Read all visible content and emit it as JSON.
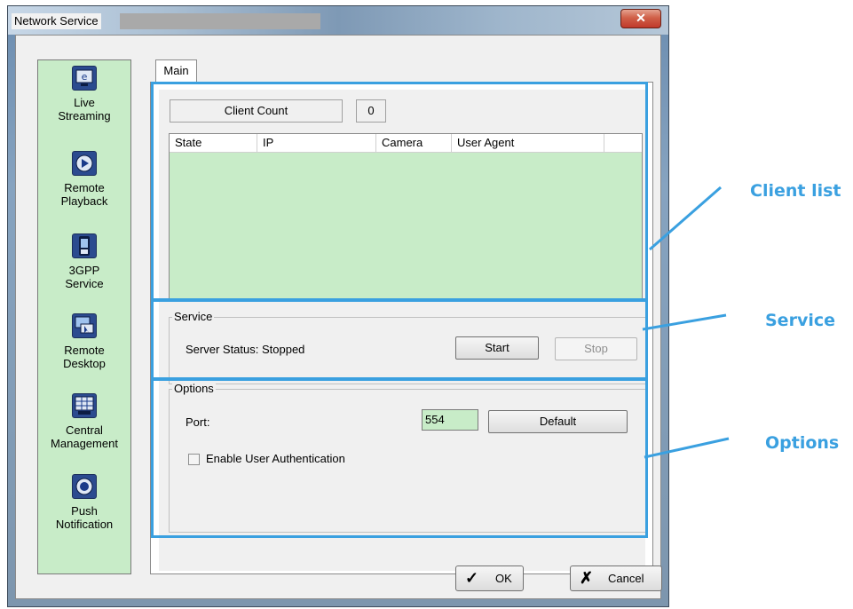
{
  "window": {
    "title": "Network Service",
    "close_glyph": "✕"
  },
  "sidebar": {
    "items": [
      {
        "label_lines": [
          "Live",
          "Streaming"
        ],
        "icon": "live-streaming-icon"
      },
      {
        "label_lines": [
          "Remote",
          "Playback"
        ],
        "icon": "remote-playback-icon"
      },
      {
        "label_lines": [
          "3GPP",
          "Service"
        ],
        "icon": "3gpp-service-icon"
      },
      {
        "label_lines": [
          "Remote",
          "Desktop"
        ],
        "icon": "remote-desktop-icon"
      },
      {
        "label_lines": [
          "Central",
          "Management"
        ],
        "icon": "central-management-icon"
      },
      {
        "label_lines": [
          "Push",
          "Notification"
        ],
        "icon": "push-notification-icon"
      }
    ]
  },
  "tabs": [
    {
      "label": "Main"
    }
  ],
  "client_list": {
    "count_label": "Client Count",
    "count_value": "0",
    "columns": [
      "State",
      "IP",
      "Camera",
      "User Agent"
    ],
    "rows": []
  },
  "service": {
    "group_label": "Service",
    "status_text": "Server Status: Stopped",
    "start_label": "Start",
    "stop_label": "Stop"
  },
  "options": {
    "group_label": "Options",
    "port_label": "Port:",
    "port_value": "554",
    "default_label": "Default",
    "auth_label": "Enable User Authentication",
    "auth_checked": false
  },
  "footer": {
    "ok_label": "OK",
    "cancel_label": "Cancel",
    "ok_glyph": "✓",
    "cancel_glyph": "✗"
  },
  "annotations": {
    "client_list": "Client list",
    "service": "Service",
    "options": "Options",
    "color": "#3aa0e0"
  }
}
